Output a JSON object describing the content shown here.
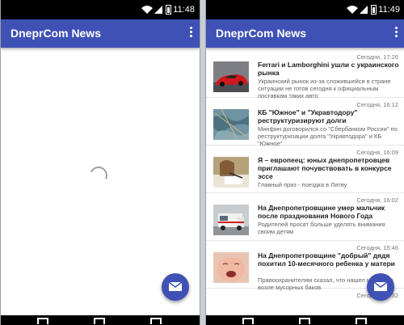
{
  "status_left": {
    "time": "11:48"
  },
  "status_right": {
    "time": "11:49"
  },
  "app_title": "DneprCom News",
  "colors": {
    "primary": "#3f51b5",
    "accent": "#3f51b5"
  },
  "icons": {
    "menu": "more-vert-icon",
    "fab": "mail-icon"
  },
  "news": [
    {
      "date": "Сегодня, 17:26",
      "headline": "Ferrari и Lamborghini ушли с украинского рынка",
      "snippet": "Украинский рынок из-за сложившейся в стране ситуации не готов сегодня к официальным поставкам таких авто",
      "thumb": "red-sports-car"
    },
    {
      "date": "Сегодня, 16:12",
      "headline": "КБ \"Южное\" и \"Укравтодору\" реструктуризируют долги",
      "snippet": "Минфин договорился со \"Сбербанком России\" по реструктуризации долга \"Укравтодора\" и КБ \"Южное\"",
      "thumb": "aerial-map"
    },
    {
      "date": "Сегодня, 16:09",
      "headline": "Я – европеец: юных днепропетровцев приглашают почувствовать в конкурсе эссе",
      "snippet": "Главный приз - поездка в Литву",
      "thumb": "student-writing"
    },
    {
      "date": "Сегодня, 16:02",
      "headline": "На Днепропетровщине умер мальчик после празднования Нового Года",
      "snippet": "Родителей просят больше уделять внимания своим детям",
      "thumb": "ambulance"
    },
    {
      "date": "Сегодня, 15:46",
      "headline": "На Днепропетровщине \"добрый\" дядя похитил 10-месячного ребенка у матери",
      "snippet": "Правоохранителям сказал, что нашел мальчика возле мусорных баков",
      "thumb": "crying-baby"
    },
    {
      "date": "Сегодня, 15:32",
      "headline": "",
      "snippet": "",
      "thumb": ""
    }
  ]
}
